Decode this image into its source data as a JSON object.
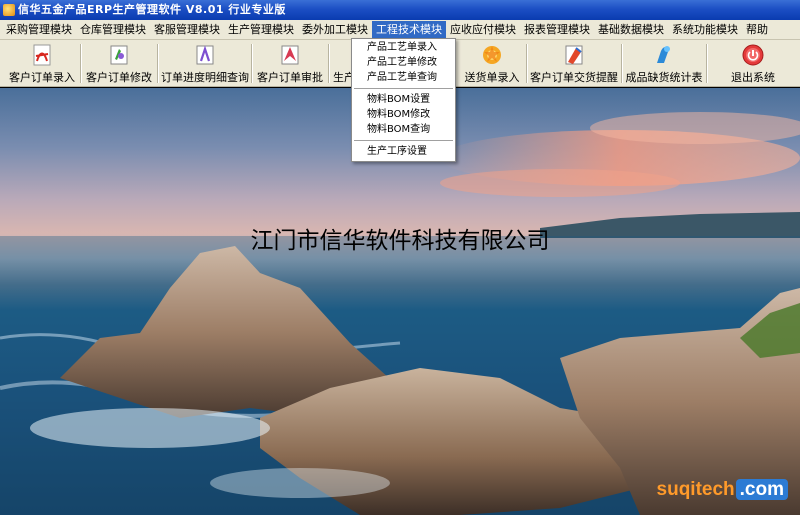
{
  "window": {
    "title": "信华五金产品ERP生产管理软件   V8.01 行业专业版"
  },
  "menu": [
    "采购管理模块",
    "仓库管理模块",
    "客服管理模块",
    "生产管理模块",
    "委外加工模块",
    "工程技术模块",
    "应收应付模块",
    "报表管理模块",
    "基础数据模块",
    "系统功能模块",
    "帮助"
  ],
  "active_menu_index": 5,
  "toolbar": {
    "buttons": [
      {
        "label": "客户订单录入",
        "icon": "pdf-icon"
      },
      {
        "label": "客户订单修改",
        "icon": "edit-doc-icon"
      },
      {
        "label": "订单进度明细查询",
        "icon": "search-doc-icon"
      },
      {
        "label": "客户订单审批",
        "icon": "approve-icon"
      },
      {
        "label": "生产",
        "icon": "production-icon"
      },
      {
        "label": "送货单录入",
        "icon": "delivery-icon"
      },
      {
        "label": "客户订单交货提醒",
        "icon": "reminder-icon"
      },
      {
        "label": "成品缺货统计表",
        "icon": "stats-icon"
      },
      {
        "label": "退出系统",
        "icon": "power-icon"
      }
    ]
  },
  "dropdown": {
    "groups": [
      [
        "产品工艺单录入",
        "产品工艺单修改",
        "产品工艺单查询"
      ],
      [
        "物料BOM设置",
        "物料BOM修改",
        "物料BOM查询"
      ],
      [
        "生产工序设置"
      ]
    ]
  },
  "company_name": "江门市信华软件科技有限公司",
  "watermark": {
    "main": "suqitech",
    "suffix": ".com"
  }
}
